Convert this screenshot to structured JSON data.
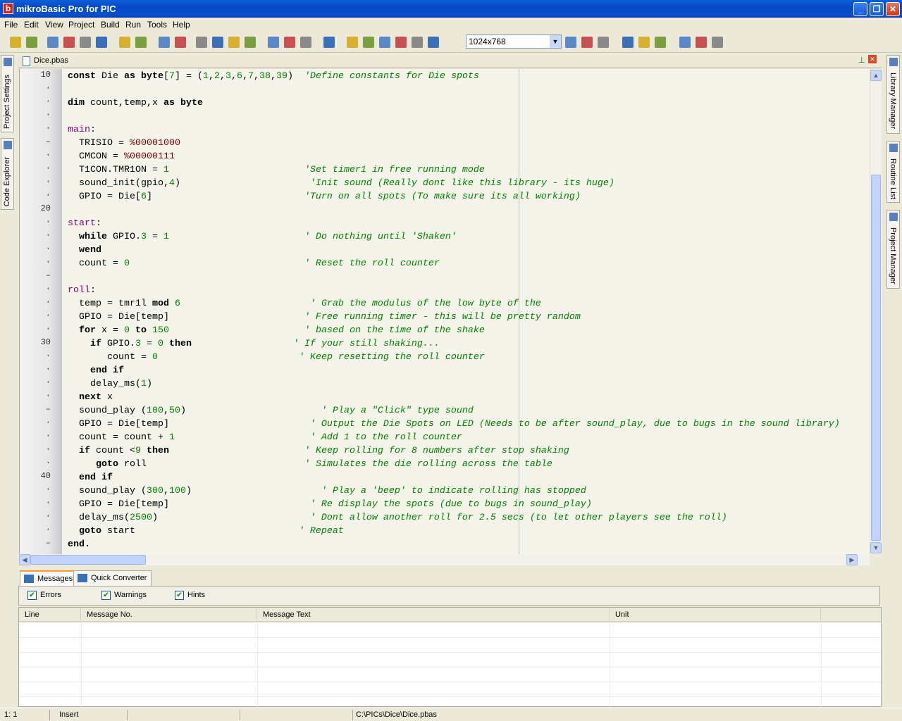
{
  "window": {
    "title": "mikroBasic Pro for PIC",
    "controls": [
      "_",
      "❐",
      "✕"
    ]
  },
  "menu": [
    "File",
    "Edit",
    "View",
    "Project",
    "Build",
    "Run",
    "Tools",
    "Help"
  ],
  "toolbar": {
    "icons": [
      "new-project-icon",
      "open-project-icon",
      "save-project-icon",
      "edit-project-icon",
      "close-project-icon",
      "project-settings-icon",
      "add-file-icon",
      "remove-file-icon",
      "new-file-icon",
      "open-file-icon",
      "save-file-icon",
      "save-all-icon",
      "print-preview-icon",
      "print-icon",
      "build-icon",
      "build-all-icon",
      "build-program-icon",
      "programmer-icon",
      "view-assembly-icon",
      "statistics-icon",
      "ascii-chart-icon",
      "code-templates-icon",
      "uart-terminal-icon",
      "lcd-designer-icon"
    ],
    "icons2": [
      "layout-save-icon",
      "layout-load-icon",
      "layout-icon",
      "italic-comment-icon",
      "slash-icon",
      "usb-icon",
      "help-icon",
      "find-icon",
      "find-next-icon"
    ],
    "layout_select": "1024x768"
  },
  "left_panels": [
    "Project Settings",
    "Code Explorer"
  ],
  "right_panels": [
    "Library Manager",
    "Routine List",
    "Project Manager"
  ],
  "editor": {
    "tab": "Dice.pbas",
    "lines": [
      {
        "g": "10",
        "t": [
          [
            "k",
            "const"
          ],
          [
            "x",
            " Die "
          ],
          [
            "k",
            "as"
          ],
          [
            "x",
            " "
          ],
          [
            "k",
            "byte"
          ],
          [
            "x",
            "["
          ],
          [
            "n",
            "7"
          ],
          [
            "x",
            "] = ("
          ],
          [
            "n",
            "1"
          ],
          [
            "x",
            ","
          ],
          [
            "n",
            "2"
          ],
          [
            "x",
            ","
          ],
          [
            "n",
            "3"
          ],
          [
            "x",
            ","
          ],
          [
            "n",
            "6"
          ],
          [
            "x",
            ","
          ],
          [
            "n",
            "7"
          ],
          [
            "x",
            ","
          ],
          [
            "n",
            "38"
          ],
          [
            "x",
            ","
          ],
          [
            "n",
            "39"
          ],
          [
            "x",
            ")  "
          ],
          [
            "c",
            "'Define constants for Die spots"
          ]
        ]
      },
      {
        "g": "·",
        "t": []
      },
      {
        "g": "·",
        "t": [
          [
            "k",
            "dim"
          ],
          [
            "x",
            " count,temp,x "
          ],
          [
            "k",
            "as"
          ],
          [
            "x",
            " "
          ],
          [
            "k",
            "byte"
          ]
        ]
      },
      {
        "g": "·",
        "t": []
      },
      {
        "g": "·",
        "t": [
          [
            "lb",
            "main"
          ],
          [
            "x",
            ":"
          ]
        ]
      },
      {
        "g": "–",
        "t": [
          [
            "x",
            "  TRISIO = "
          ],
          [
            "s",
            "%00001000"
          ]
        ]
      },
      {
        "g": "·",
        "t": [
          [
            "x",
            "  CMCON = "
          ],
          [
            "s",
            "%00000111"
          ]
        ]
      },
      {
        "g": "·",
        "t": [
          [
            "x",
            "  T1CON.TMR1ON = "
          ],
          [
            "n",
            "1"
          ],
          [
            "x",
            "                        "
          ],
          [
            "c",
            "'Set timer1 in free running mode"
          ]
        ]
      },
      {
        "g": "·",
        "t": [
          [
            "x",
            "  sound_init(gpio,"
          ],
          [
            "n",
            "4"
          ],
          [
            "x",
            ")                       "
          ],
          [
            "c",
            "'Init sound (Really dont like this library - its huge)"
          ]
        ]
      },
      {
        "g": "·",
        "t": [
          [
            "x",
            "  GPIO = Die["
          ],
          [
            "n",
            "6"
          ],
          [
            "x",
            "]                           "
          ],
          [
            "c",
            "'Turn on all spots (To make sure its all working)"
          ]
        ]
      },
      {
        "g": "20",
        "t": []
      },
      {
        "g": "·",
        "t": [
          [
            "lb",
            "start"
          ],
          [
            "x",
            ":"
          ]
        ]
      },
      {
        "g": "·",
        "t": [
          [
            "x",
            "  "
          ],
          [
            "k",
            "while"
          ],
          [
            "x",
            " GPIO."
          ],
          [
            "n",
            "3"
          ],
          [
            "x",
            " = "
          ],
          [
            "n",
            "1"
          ],
          [
            "x",
            "                        "
          ],
          [
            "c",
            "' Do nothing until 'Shaken'"
          ]
        ]
      },
      {
        "g": "·",
        "t": [
          [
            "x",
            "  "
          ],
          [
            "k",
            "wend"
          ]
        ]
      },
      {
        "g": "·",
        "t": [
          [
            "x",
            "  count = "
          ],
          [
            "n",
            "0"
          ],
          [
            "x",
            "                               "
          ],
          [
            "c",
            "' Reset the roll counter"
          ]
        ]
      },
      {
        "g": "–",
        "t": []
      },
      {
        "g": "·",
        "t": [
          [
            "lb",
            "roll"
          ],
          [
            "x",
            ":"
          ]
        ]
      },
      {
        "g": "·",
        "t": [
          [
            "x",
            "  temp = tmr1l "
          ],
          [
            "k",
            "mod"
          ],
          [
            "x",
            " "
          ],
          [
            "n",
            "6"
          ],
          [
            "x",
            "                       "
          ],
          [
            "c",
            "' Grab the modulus of the low byte of the"
          ]
        ]
      },
      {
        "g": "·",
        "t": [
          [
            "x",
            "  GPIO = Die[temp]                        "
          ],
          [
            "c",
            "' Free running timer - this will be pretty random"
          ]
        ]
      },
      {
        "g": "·",
        "t": [
          [
            "x",
            "  "
          ],
          [
            "k",
            "for"
          ],
          [
            "x",
            " x = "
          ],
          [
            "n",
            "0"
          ],
          [
            "x",
            " "
          ],
          [
            "k",
            "to"
          ],
          [
            "x",
            " "
          ],
          [
            "n",
            "150"
          ],
          [
            "x",
            "                        "
          ],
          [
            "c",
            "' based on the time of the shake"
          ]
        ]
      },
      {
        "g": "30",
        "t": [
          [
            "x",
            "    "
          ],
          [
            "k",
            "if"
          ],
          [
            "x",
            " GPIO."
          ],
          [
            "n",
            "3"
          ],
          [
            "x",
            " = "
          ],
          [
            "n",
            "0"
          ],
          [
            "x",
            " "
          ],
          [
            "k",
            "then"
          ],
          [
            "x",
            "                  "
          ],
          [
            "c",
            "' If your still shaking..."
          ]
        ]
      },
      {
        "g": "·",
        "t": [
          [
            "x",
            "       count = "
          ],
          [
            "n",
            "0"
          ],
          [
            "x",
            "                         "
          ],
          [
            "c",
            "' Keep resetting the roll counter"
          ]
        ]
      },
      {
        "g": "·",
        "t": [
          [
            "x",
            "    "
          ],
          [
            "k",
            "end if"
          ]
        ]
      },
      {
        "g": "·",
        "t": [
          [
            "x",
            "    delay_ms("
          ],
          [
            "n",
            "1"
          ],
          [
            "x",
            ")"
          ]
        ]
      },
      {
        "g": "·",
        "t": [
          [
            "x",
            "  "
          ],
          [
            "k",
            "next"
          ],
          [
            "x",
            " x"
          ]
        ]
      },
      {
        "g": "–",
        "t": [
          [
            "x",
            "  sound_play ("
          ],
          [
            "n",
            "100"
          ],
          [
            "x",
            ","
          ],
          [
            "n",
            "50"
          ],
          [
            "x",
            ")                        "
          ],
          [
            "c",
            "' Play a \"Click\" type sound"
          ]
        ]
      },
      {
        "g": "·",
        "t": [
          [
            "x",
            "  GPIO = Die[temp]                         "
          ],
          [
            "c",
            "' Output the Die Spots on LED (Needs to be after sound_play, due to bugs in the sound library)"
          ]
        ]
      },
      {
        "g": "·",
        "t": [
          [
            "x",
            "  count = count + "
          ],
          [
            "n",
            "1"
          ],
          [
            "x",
            "                        "
          ],
          [
            "c",
            "' Add 1 to the roll counter"
          ]
        ]
      },
      {
        "g": "·",
        "t": [
          [
            "x",
            "  "
          ],
          [
            "k",
            "if"
          ],
          [
            "x",
            " count <"
          ],
          [
            "n",
            "9"
          ],
          [
            "x",
            " "
          ],
          [
            "k",
            "then"
          ],
          [
            "x",
            "                        "
          ],
          [
            "c",
            "' Keep rolling for 8 numbers after stop shaking"
          ]
        ]
      },
      {
        "g": "·",
        "t": [
          [
            "x",
            "     "
          ],
          [
            "k",
            "goto"
          ],
          [
            "x",
            " roll                            "
          ],
          [
            "c",
            "' Simulates the die rolling across the table"
          ]
        ]
      },
      {
        "g": "40",
        "t": [
          [
            "x",
            "  "
          ],
          [
            "k",
            "end if"
          ]
        ]
      },
      {
        "g": "·",
        "t": [
          [
            "x",
            "  sound_play ("
          ],
          [
            "n",
            "300"
          ],
          [
            "x",
            ","
          ],
          [
            "n",
            "100"
          ],
          [
            "x",
            ")                       "
          ],
          [
            "c",
            "' Play a 'beep' to indicate rolling has stopped"
          ]
        ]
      },
      {
        "g": "·",
        "t": [
          [
            "x",
            "  GPIO = Die[temp]                         "
          ],
          [
            "c",
            "' Re display the spots (due to bugs in sound_play)"
          ]
        ]
      },
      {
        "g": "·",
        "t": [
          [
            "x",
            "  delay_ms("
          ],
          [
            "n",
            "2500"
          ],
          [
            "x",
            ")                           "
          ],
          [
            "c",
            "' Dont allow another roll for 2.5 secs (to let other players see the roll)"
          ]
        ]
      },
      {
        "g": "·",
        "t": [
          [
            "x",
            "  "
          ],
          [
            "k",
            "goto"
          ],
          [
            "x",
            " start                             "
          ],
          [
            "c",
            "' Repeat"
          ]
        ]
      },
      {
        "g": "–",
        "t": [
          [
            "k",
            "end."
          ]
        ]
      }
    ]
  },
  "messages": {
    "tabs": [
      "Messages",
      "Quick Converter"
    ],
    "filters": [
      {
        "label": "Errors",
        "checked": true
      },
      {
        "label": "Warnings",
        "checked": true
      },
      {
        "label": "Hints",
        "checked": true
      }
    ],
    "columns": [
      "Line",
      "Message No.",
      "Message Text",
      "Unit"
    ],
    "rows": []
  },
  "status": {
    "position": "1: 1",
    "mode": "Insert",
    "file": "C:\\PICs\\Dice\\Dice.pbas"
  },
  "colors": {
    "keyword": "#000000",
    "number": "#008000",
    "binary": "#800000",
    "label": "#800080",
    "comment": "#008000",
    "editor_bg": "#f5f4ea",
    "titlebar": "#0548c4"
  }
}
